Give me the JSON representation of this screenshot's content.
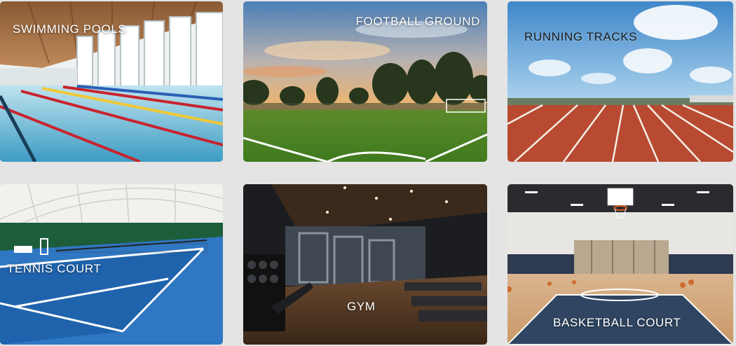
{
  "facilities": [
    {
      "id": "swim",
      "label": "SWIMMING POOLS",
      "icon": "swimming-pool-photo"
    },
    {
      "id": "foot",
      "label": "FOOTBALL GROUND",
      "icon": "football-ground-photo"
    },
    {
      "id": "track",
      "label": "RUNNING TRACKS",
      "icon": "running-track-photo"
    },
    {
      "id": "tennis",
      "label": "TENNIS COURT",
      "icon": "tennis-court-photo"
    },
    {
      "id": "gym",
      "label": "GYM",
      "icon": "gym-photo"
    },
    {
      "id": "bball",
      "label": "BASKETBALL COURT",
      "icon": "basketball-court-photo"
    }
  ],
  "colors": {
    "background": "#e4e4e4",
    "label_text": "#ffffff"
  }
}
